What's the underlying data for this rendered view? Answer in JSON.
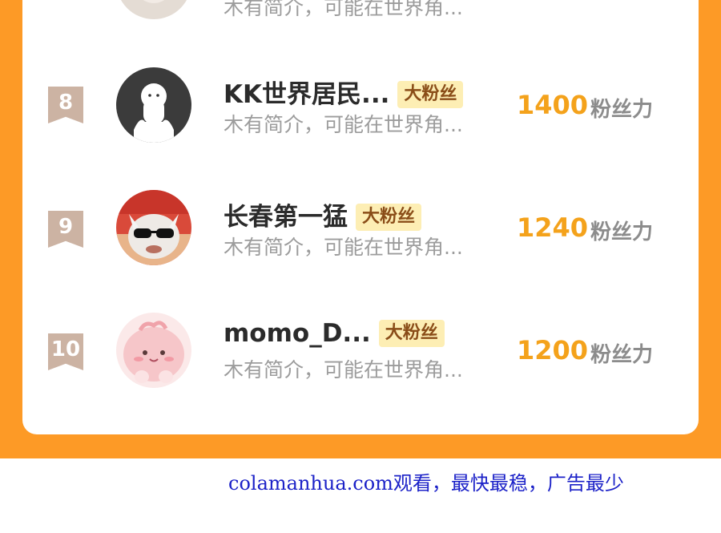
{
  "top_partial": {
    "desc": "木有简介，可能在世界角..."
  },
  "rows": [
    {
      "rank": "8",
      "name": "KK世界居民...",
      "badge": "大粉丝",
      "desc": "木有简介，可能在世界角...",
      "score": "1400",
      "score_label": "粉丝力",
      "avatar": "avatar-ghost-icon"
    },
    {
      "rank": "9",
      "name": "长春第一猛",
      "badge": "大粉丝",
      "desc": "木有简介，可能在世界角...",
      "score": "1240",
      "score_label": "粉丝力",
      "avatar": "avatar-cartoon-sunglasses-icon"
    },
    {
      "rank": "10",
      "name": "momo_D...",
      "badge": "大粉丝",
      "desc": "木有简介，可能在世界角...",
      "score": "1200",
      "score_label": "粉丝力",
      "avatar": "avatar-pink-blob-icon"
    }
  ],
  "watermark": "colamanhua.com观看，最快最稳，广告最少",
  "colors": {
    "frame": "#fd9a26",
    "score": "#f4a21b",
    "badge_bg": "#fdeeb4",
    "rank_bg": "#ccb3a3",
    "watermark": "#1c22c8"
  }
}
